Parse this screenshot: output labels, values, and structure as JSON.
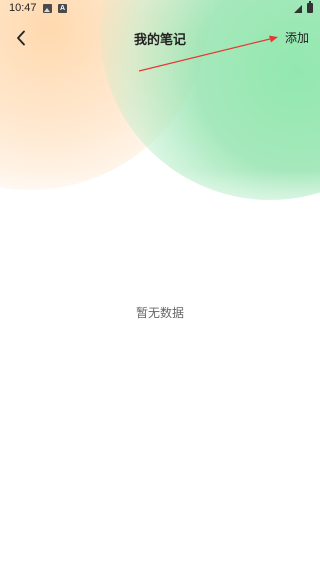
{
  "status_bar": {
    "time": "10:47",
    "notification_icons": [
      "image-icon",
      "a-icon"
    ],
    "notification_a_label": "A",
    "system_icons": [
      "signal-icon",
      "battery-icon"
    ]
  },
  "header": {
    "back_icon": "chevron-left-icon",
    "title": "我的笔记",
    "add_label": "添加"
  },
  "main": {
    "empty_text": "暂无数据"
  },
  "colors": {
    "gradient_orange": "#FFD9AE",
    "gradient_green": "#8EE6AA",
    "annotation_arrow": "#E53935"
  }
}
